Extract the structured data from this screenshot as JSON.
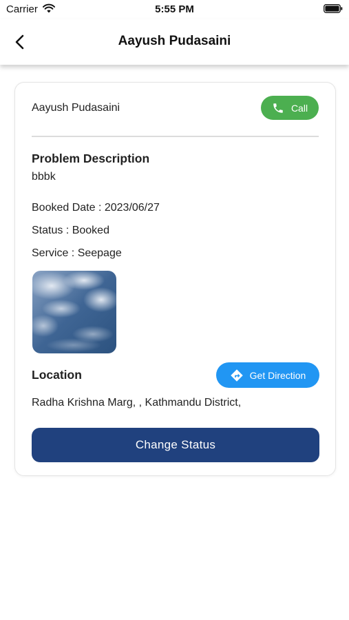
{
  "status_bar": {
    "carrier": "Carrier",
    "time": "5:55 PM"
  },
  "header": {
    "title": "Aayush Pudasaini"
  },
  "booking": {
    "customer_name": "Aayush Pudasaini",
    "call_label": "Call",
    "problem_heading": "Problem Description",
    "problem_text": "bbbk",
    "booked_date": "Booked Date : 2023/06/27",
    "status": "Status :  Booked",
    "service": "Service :  Seepage",
    "location_heading": "Location",
    "direction_label": "Get Direction",
    "address": "Radha Krishna Marg, , Kathmandu District,",
    "change_status_label": "Change Status"
  },
  "colors": {
    "call_button": "#4caf50",
    "direction_button": "#2196f3",
    "change_status_button": "#20417e"
  },
  "icons": {
    "back": "chevron-left-icon",
    "call": "phone-icon",
    "direction": "directions-icon"
  }
}
